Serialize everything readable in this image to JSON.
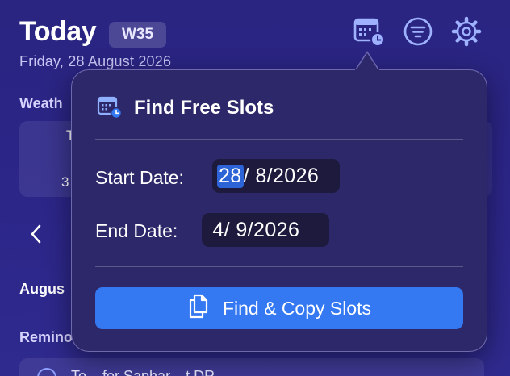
{
  "header": {
    "title": "Today",
    "week_badge": "W35",
    "date": "Friday, 28 August 2026",
    "icons": [
      "calendar-clock-icon",
      "filter-icon",
      "gear-icon"
    ]
  },
  "background": {
    "weather_label": "Weath",
    "weather_fragment_a": "T",
    "weather_fragment_b": "3",
    "month_label": "Augus",
    "reminders_label": "Remino",
    "reminder_item": "To... for Saphar... t DR..."
  },
  "popover": {
    "title": "Find Free Slots",
    "start": {
      "label": "Start Date:",
      "day": "28",
      "month": " 8",
      "year": "2026"
    },
    "end": {
      "label": "End Date:",
      "day": " 4",
      "month": " 9",
      "year": "2026"
    },
    "cta_label": "Find & Copy Slots"
  },
  "colors": {
    "background": "#2b2587",
    "popover": "#2d2869",
    "accent": "#3478f2",
    "selection": "#2c63d6"
  }
}
